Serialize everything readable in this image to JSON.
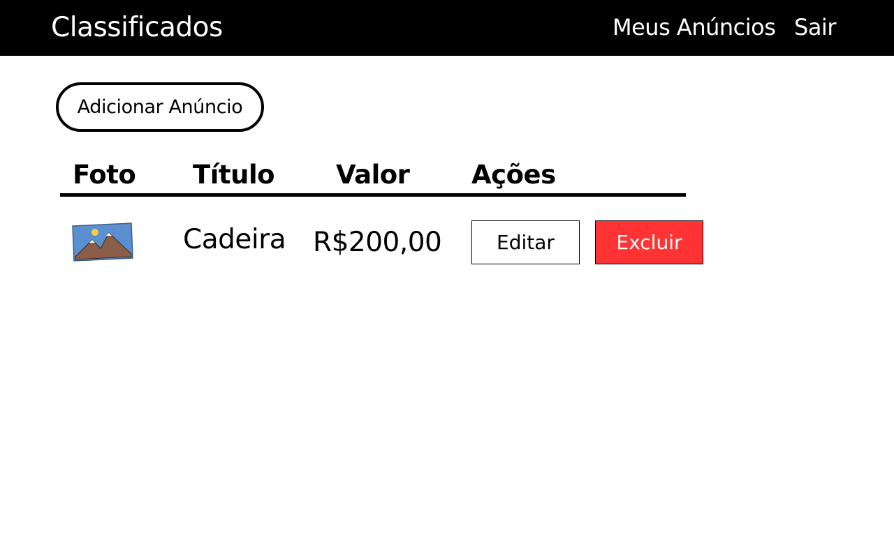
{
  "header": {
    "brand": "Classificados",
    "nav": {
      "my_ads": "Meus Anúncios",
      "logout": "Sair"
    }
  },
  "toolbar": {
    "add_ad_label": "Adicionar Anúncio"
  },
  "table": {
    "columns": [
      "Foto",
      "Título",
      "Valor",
      "Ações"
    ],
    "rows": [
      {
        "photo_icon": "image-placeholder-icon",
        "title": "Cadeira",
        "value": "R$200,00",
        "actions": {
          "edit_label": "Editar",
          "delete_label": "Excluir"
        }
      }
    ]
  },
  "colors": {
    "header_bg": "#000000",
    "delete_button": "#ff3333"
  }
}
